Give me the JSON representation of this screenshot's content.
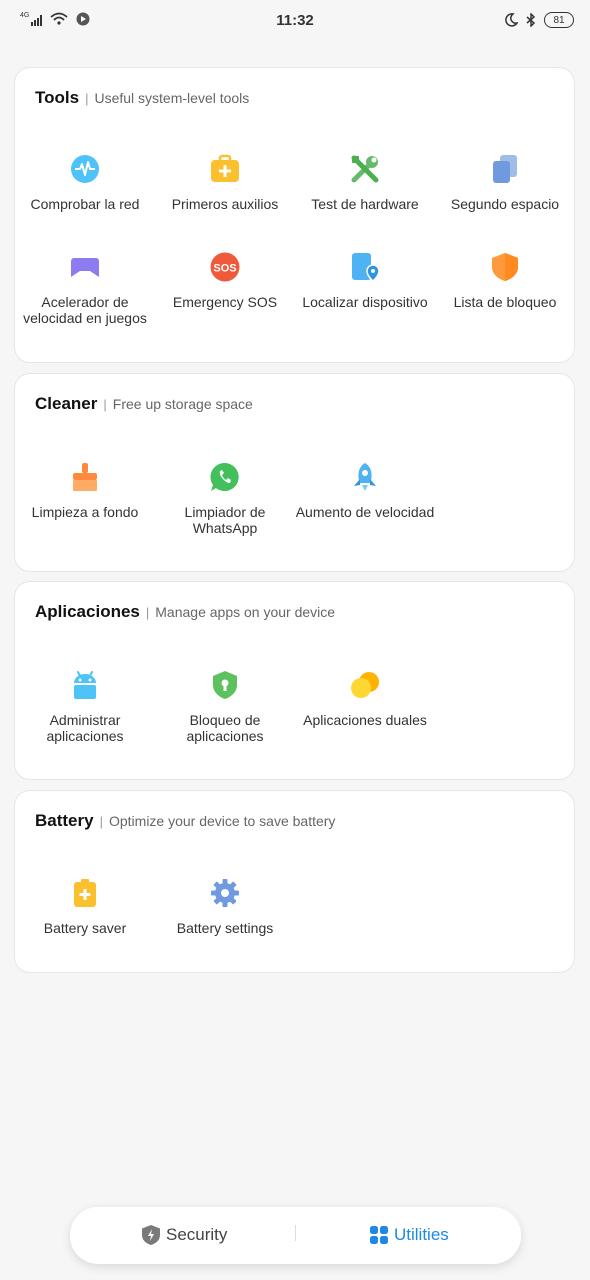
{
  "status_bar": {
    "network": "4G",
    "time": "11:32",
    "battery": "81"
  },
  "sections": {
    "tools": {
      "title": "Tools",
      "subtitle": "Useful system-level tools",
      "items": [
        {
          "label": "Comprobar la red",
          "icon": "network-check-icon",
          "color": "#4fc3f7"
        },
        {
          "label": "Primeros auxilios",
          "icon": "first-aid-kit-icon",
          "color": "#fbc02d"
        },
        {
          "label": "Test de hardware",
          "icon": "tools-icon",
          "color": "#66bb6a"
        },
        {
          "label": "Segundo espacio",
          "icon": "second-space-icon",
          "color": "#7ea7e0"
        },
        {
          "label": "Acelerador de velocidad en juegos",
          "icon": "gamepad-icon",
          "color": "#8c7cf0"
        },
        {
          "label": "Emergency SOS",
          "icon": "sos-icon",
          "color": "#ef5a3d"
        },
        {
          "label": "Localizar dispositivo",
          "icon": "locate-device-icon",
          "color": "#4fb3f3"
        },
        {
          "label": "Lista de bloqueo",
          "icon": "blocklist-shield-icon",
          "color": "#ff9a3c"
        }
      ]
    },
    "cleaner": {
      "title": "Cleaner",
      "subtitle": "Free up storage space",
      "items": [
        {
          "label": "Limpieza a fondo",
          "icon": "broom-icon",
          "color": "#ff8a3d"
        },
        {
          "label": "Limpiador de WhatsApp",
          "icon": "whatsapp-icon",
          "color": "#43c05b"
        },
        {
          "label": "Aumento de velocidad",
          "icon": "rocket-icon",
          "color": "#4fb3f3"
        }
      ]
    },
    "apps": {
      "title": "Aplicaciones",
      "subtitle": "Manage apps on your device",
      "items": [
        {
          "label": "Administrar aplicaciones",
          "icon": "android-icon",
          "color": "#4fc3f7"
        },
        {
          "label": "Bloqueo de aplicaciones",
          "icon": "app-lock-shield-icon",
          "color": "#5cc15e"
        },
        {
          "label": "Aplicaciones duales",
          "icon": "dual-apps-icon",
          "color": "#fbc02d"
        }
      ]
    },
    "battery": {
      "title": "Battery",
      "subtitle": "Optimize your device to save battery",
      "items": [
        {
          "label": "Battery saver",
          "icon": "battery-saver-icon",
          "color": "#fbc02d"
        },
        {
          "label": "Battery settings",
          "icon": "gear-icon",
          "color": "#6f9ae0"
        }
      ]
    }
  },
  "bottom_nav": {
    "security_label": "Security",
    "utilities_label": "Utilities",
    "active": "utilities",
    "active_color": "#1e88e5",
    "inactive_color": "#444444"
  }
}
